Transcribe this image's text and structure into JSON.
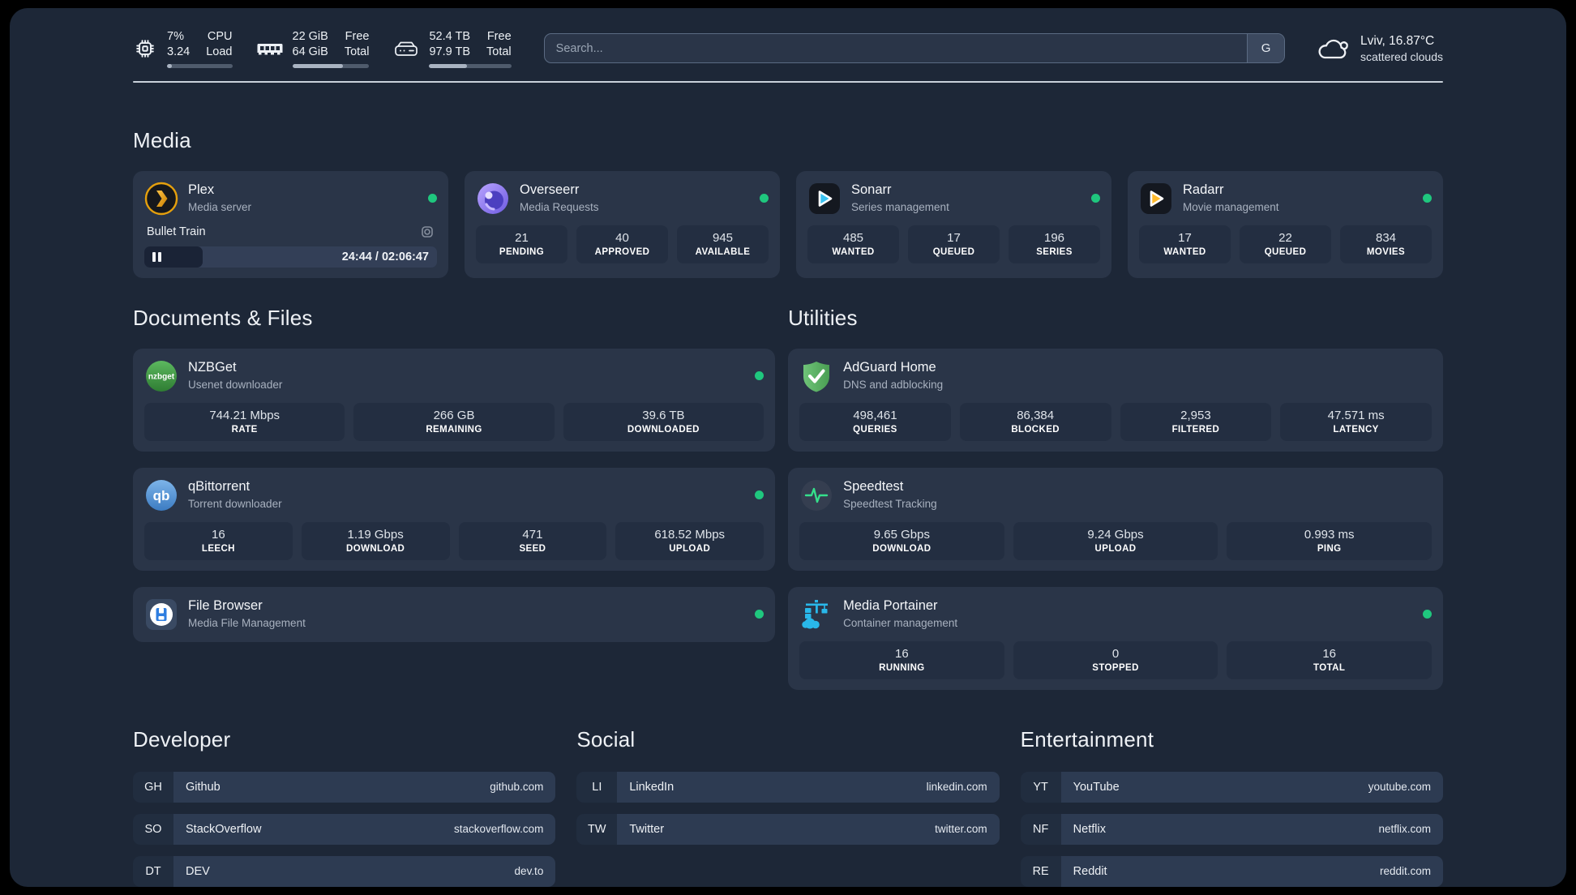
{
  "header": {
    "system": [
      {
        "icon": "cpu-icon",
        "col1": [
          "7%",
          "3.24"
        ],
        "col2": [
          "CPU",
          "Load"
        ],
        "progress": 7
      },
      {
        "icon": "memory-icon",
        "col1": [
          "22 GiB",
          "64 GiB"
        ],
        "col2": [
          "Free",
          "Total"
        ],
        "progress": 66
      },
      {
        "icon": "storage-icon",
        "col1": [
          "52.4 TB",
          "97.9 TB"
        ],
        "col2": [
          "Free",
          "Total"
        ],
        "progress": 46
      }
    ],
    "search": {
      "placeholder": "Search...",
      "button": "G"
    },
    "weather": {
      "line1": "Lviv, 16.87°C",
      "line2": "scattered clouds"
    }
  },
  "media": {
    "title": "Media",
    "plex": {
      "name": "Plex",
      "subtitle": "Media server",
      "now_playing": "Bullet Train",
      "time": "24:44 / 02:06:47",
      "progress": 20
    },
    "overseerr": {
      "name": "Overseerr",
      "subtitle": "Media Requests",
      "stats": [
        {
          "value": "21",
          "label": "PENDING"
        },
        {
          "value": "40",
          "label": "APPROVED"
        },
        {
          "value": "945",
          "label": "AVAILABLE"
        }
      ]
    },
    "sonarr": {
      "name": "Sonarr",
      "subtitle": "Series management",
      "stats": [
        {
          "value": "485",
          "label": "WANTED"
        },
        {
          "value": "17",
          "label": "QUEUED"
        },
        {
          "value": "196",
          "label": "SERIES"
        }
      ]
    },
    "radarr": {
      "name": "Radarr",
      "subtitle": "Movie management",
      "stats": [
        {
          "value": "17",
          "label": "WANTED"
        },
        {
          "value": "22",
          "label": "QUEUED"
        },
        {
          "value": "834",
          "label": "MOVIES"
        }
      ]
    }
  },
  "documents": {
    "title": "Documents & Files",
    "nzbget": {
      "name": "NZBGet",
      "subtitle": "Usenet downloader",
      "icon_text": "nzbget",
      "stats": [
        {
          "value": "744.21 Mbps",
          "label": "RATE"
        },
        {
          "value": "266 GB",
          "label": "REMAINING"
        },
        {
          "value": "39.6 TB",
          "label": "DOWNLOADED"
        }
      ]
    },
    "qbittorrent": {
      "name": "qBittorrent",
      "subtitle": "Torrent downloader",
      "icon_text": "qb",
      "stats": [
        {
          "value": "16",
          "label": "LEECH"
        },
        {
          "value": "1.19 Gbps",
          "label": "DOWNLOAD"
        },
        {
          "value": "471",
          "label": "SEED"
        },
        {
          "value": "618.52 Mbps",
          "label": "UPLOAD"
        }
      ]
    },
    "filebrowser": {
      "name": "File Browser",
      "subtitle": "Media File Management"
    }
  },
  "utilities": {
    "title": "Utilities",
    "adguard": {
      "name": "AdGuard Home",
      "subtitle": "DNS and adblocking",
      "stats": [
        {
          "value": "498,461",
          "label": "QUERIES"
        },
        {
          "value": "86,384",
          "label": "BLOCKED"
        },
        {
          "value": "2,953",
          "label": "FILTERED"
        },
        {
          "value": "47.571 ms",
          "label": "LATENCY"
        }
      ]
    },
    "speedtest": {
      "name": "Speedtest",
      "subtitle": "Speedtest Tracking",
      "stats": [
        {
          "value": "9.65 Gbps",
          "label": "DOWNLOAD"
        },
        {
          "value": "9.24 Gbps",
          "label": "UPLOAD"
        },
        {
          "value": "0.993 ms",
          "label": "PING"
        }
      ]
    },
    "portainer": {
      "name": "Media Portainer",
      "subtitle": "Container management",
      "stats": [
        {
          "value": "16",
          "label": "RUNNING"
        },
        {
          "value": "0",
          "label": "STOPPED"
        },
        {
          "value": "16",
          "label": "TOTAL"
        }
      ]
    }
  },
  "links": {
    "developer": {
      "title": "Developer",
      "items": [
        {
          "abbr": "GH",
          "name": "Github",
          "url": "github.com"
        },
        {
          "abbr": "SO",
          "name": "StackOverflow",
          "url": "stackoverflow.com"
        },
        {
          "abbr": "DT",
          "name": "DEV",
          "url": "dev.to"
        }
      ]
    },
    "social": {
      "title": "Social",
      "items": [
        {
          "abbr": "LI",
          "name": "LinkedIn",
          "url": "linkedin.com"
        },
        {
          "abbr": "TW",
          "name": "Twitter",
          "url": "twitter.com"
        }
      ]
    },
    "entertainment": {
      "title": "Entertainment",
      "items": [
        {
          "abbr": "YT",
          "name": "YouTube",
          "url": "youtube.com"
        },
        {
          "abbr": "NF",
          "name": "Netflix",
          "url": "netflix.com"
        },
        {
          "abbr": "RE",
          "name": "Reddit",
          "url": "reddit.com"
        }
      ]
    }
  },
  "colors": {
    "status_online": "#1fc77e",
    "plex": "#e5a00d",
    "sonarr": "#3ac3f2",
    "radarr": "#ffbb2e",
    "nzbget": "#3f9e3f",
    "qbittorrent": "#4f8fd0",
    "overseerr": "#7b61e8",
    "adguard": "#5cb766",
    "speedtest_pulse": "#35e08b",
    "filebrowser": "#2e7ee0",
    "portainer": "#29b8ea"
  }
}
